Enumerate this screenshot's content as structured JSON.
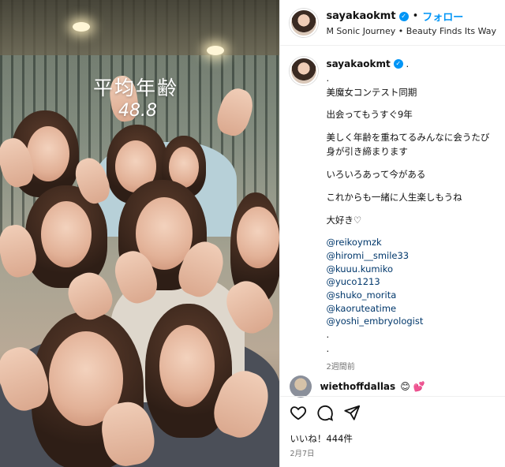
{
  "header": {
    "username": "sayakaokmt",
    "separator": "•",
    "follow_label": "フォロー",
    "audio_line": "M Sonic Journey • Beauty Finds Its Way"
  },
  "media": {
    "overlay_title": "平均年齢",
    "overlay_value": "48.8"
  },
  "caption": {
    "username": "sayakaokmt",
    "first_line": ".",
    "lines": [
      ".",
      "美魔女コンテスト同期",
      "出会ってもうすぐ9年",
      "美しく年齢を重ねてるみんなに会うたび\n身が引き締まります",
      "いろいろあって今がある",
      "これからも一緒に人生楽しもうね",
      "大好き♡"
    ],
    "mentions": [
      "@reikoymzk",
      "@hiromi__smile33",
      "@kuuu.kumiko",
      "@yuco1213",
      "@shuko_morita",
      "@kaoruteatime",
      "@yoshi_embryologist"
    ],
    "trailing_dots": [
      ".",
      "."
    ],
    "time_ago": "2週間前"
  },
  "comment": {
    "username": "wiethoffdallas",
    "text": "😊 💕"
  },
  "footer": {
    "likes": "いいね！444件",
    "date": "2月7日"
  },
  "icons": {
    "like": "heart-icon",
    "comment": "comment-icon",
    "share": "share-icon",
    "verified": "verified-badge-icon"
  }
}
